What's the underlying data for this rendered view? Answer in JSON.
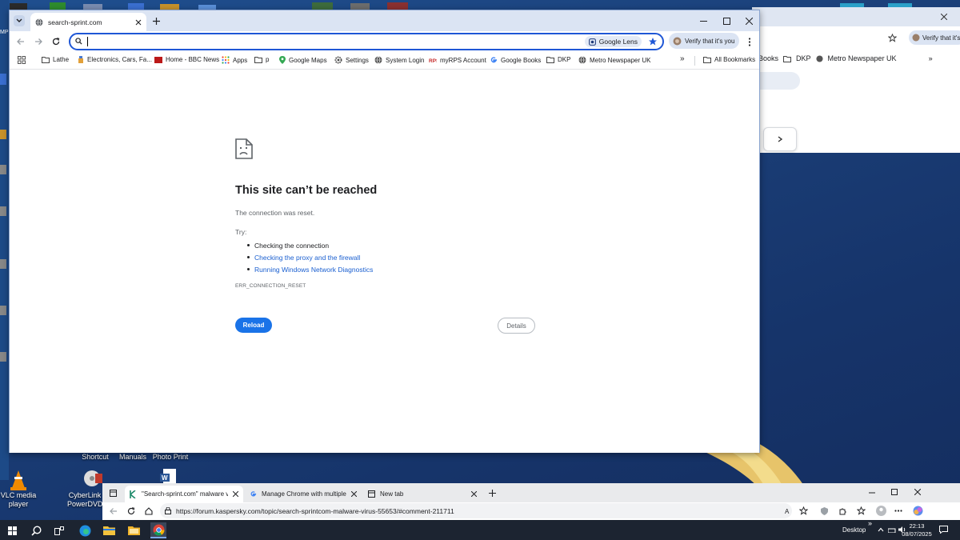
{
  "desktop": {
    "icons": [
      {
        "label": "Shortcut"
      },
      {
        "label": "Manuals"
      },
      {
        "label": "Photo Print"
      },
      {
        "label": "VLC media player"
      },
      {
        "label": "CyberLink PowerDVD"
      }
    ]
  },
  "background_window": {
    "verify_label": "Verify that it's",
    "bookmarks": [
      "Books",
      "DKP",
      "Metro Newspaper UK"
    ]
  },
  "browser": {
    "tab_title": "search-sprint.com",
    "omnibox": {
      "value": "",
      "lens_label": "Google Lens"
    },
    "profile_chip": "Verify that it's you",
    "bookmarks": [
      {
        "label": "Lathe",
        "icon": "folder-icon"
      },
      {
        "label": "Electronics, Cars, Fa...",
        "icon": "shop-icon"
      },
      {
        "label": "Home - BBC News",
        "icon": "bbc-icon"
      },
      {
        "label": "Apps",
        "icon": "apps-icon"
      },
      {
        "label": "p",
        "icon": "folder-icon"
      },
      {
        "label": "Google Maps",
        "icon": "maps-pin-icon"
      },
      {
        "label": "Settings",
        "icon": "gear-icon"
      },
      {
        "label": "System Login",
        "icon": "globe-icon"
      },
      {
        "label": "myRPS Account",
        "icon": "rps-icon"
      },
      {
        "label": "Google Books",
        "icon": "google-icon"
      },
      {
        "label": "DKP",
        "icon": "folder-icon"
      },
      {
        "label": "Metro Newspaper UK",
        "icon": "globe-icon"
      }
    ],
    "all_bookmarks": "All Bookmarks"
  },
  "error_page": {
    "title": "This site can’t be reached",
    "subtitle": "The connection was reset.",
    "try_label": "Try:",
    "suggestions": [
      {
        "text": "Checking the connection",
        "link": false
      },
      {
        "text": "Checking the proxy and the firewall",
        "link": true
      },
      {
        "text": "Running Windows Network Diagnostics",
        "link": true
      }
    ],
    "error_code": "ERR_CONNECTION_RESET",
    "reload_label": "Reload",
    "details_label": "Details"
  },
  "edge_window": {
    "tabs": [
      {
        "title": "\"Search-sprint.com\" malware virus"
      },
      {
        "title": "Manage Chrome with multiple pr"
      },
      {
        "title": "New tab"
      }
    ],
    "url": "https://forum.kaspersky.com/topic/search-sprintcom-malware-virus-55653/#comment-211711"
  },
  "taskbar": {
    "desktop_label": "Desktop",
    "time": "22:13",
    "date": "08/07/2025"
  },
  "colors": {
    "accent": "#1a73e8",
    "link": "#1a5fd0",
    "omnibox_border": "#1f57d6",
    "tabstrip": "#dbe4f3"
  }
}
